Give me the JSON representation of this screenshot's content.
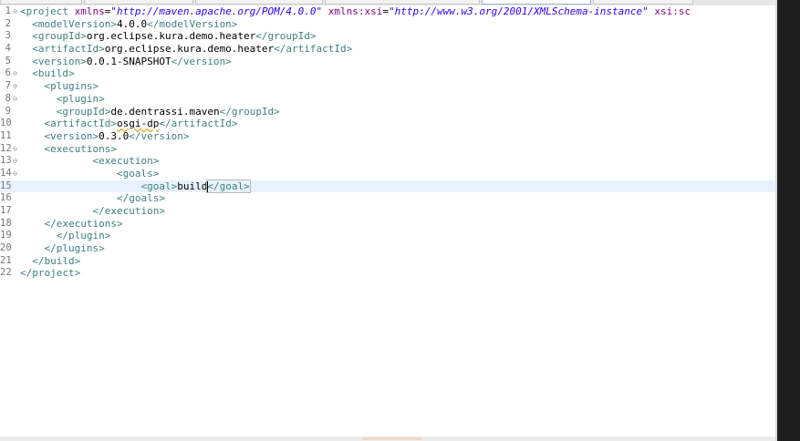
{
  "editor": {
    "lines": [
      {
        "num": "1",
        "fold": "⊖",
        "tokens": [
          [
            "tag",
            "<project "
          ],
          [
            "attr",
            "xmlns"
          ],
          [
            "plain",
            "="
          ],
          [
            "val",
            "\"http://maven.apache.org/POM/4.0.0\""
          ],
          [
            "plain",
            " "
          ],
          [
            "attr",
            "xmlns:xsi"
          ],
          [
            "plain",
            "="
          ],
          [
            "val",
            "\"http://www.w3.org/2001/XMLSchema-instance\""
          ],
          [
            "plain",
            " "
          ],
          [
            "attr",
            "xsi:sc"
          ]
        ]
      },
      {
        "num": "2",
        "fold": "",
        "tokens": [
          [
            "plain",
            "  "
          ],
          [
            "tag",
            "<modelVersion>"
          ],
          [
            "plain",
            "4.0.0"
          ],
          [
            "tag",
            "</modelVersion>"
          ]
        ]
      },
      {
        "num": "3",
        "fold": "",
        "tokens": [
          [
            "plain",
            "  "
          ],
          [
            "tag",
            "<groupId>"
          ],
          [
            "plain",
            "org.eclipse.kura.demo.heater"
          ],
          [
            "tag",
            "</groupId>"
          ]
        ]
      },
      {
        "num": "4",
        "fold": "",
        "tokens": [
          [
            "plain",
            "  "
          ],
          [
            "tag",
            "<artifactId>"
          ],
          [
            "plain",
            "org.eclipse.kura.demo.heater"
          ],
          [
            "tag",
            "</artifactId>"
          ]
        ]
      },
      {
        "num": "5",
        "fold": "",
        "tokens": [
          [
            "plain",
            "  "
          ],
          [
            "tag",
            "<version>"
          ],
          [
            "plain",
            "0.0.1-SNAPSHOT"
          ],
          [
            "tag",
            "</version>"
          ]
        ]
      },
      {
        "num": "6",
        "fold": "⊖",
        "tokens": [
          [
            "plain",
            "  "
          ],
          [
            "tag",
            "<build>"
          ]
        ]
      },
      {
        "num": "7",
        "fold": "⊖",
        "tokens": [
          [
            "plain",
            "    "
          ],
          [
            "tag",
            "<plugins>"
          ]
        ]
      },
      {
        "num": "8",
        "fold": "⊖",
        "tokens": [
          [
            "plain",
            "      "
          ],
          [
            "tag",
            "<plugin>"
          ]
        ]
      },
      {
        "num": "9",
        "fold": "",
        "tokens": [
          [
            "plain",
            "      "
          ],
          [
            "tag",
            "<groupId>"
          ],
          [
            "plain",
            "de.dentrassi.maven"
          ],
          [
            "tag",
            "</groupId>"
          ]
        ]
      },
      {
        "num": "10",
        "fold": "",
        "tokens": [
          [
            "plain",
            "    "
          ],
          [
            "tag",
            "<artifactId>"
          ],
          [
            "squiggle",
            "osgi-dp"
          ],
          [
            "tag",
            "</artifactId>"
          ]
        ]
      },
      {
        "num": "11",
        "fold": "",
        "tokens": [
          [
            "plain",
            "    "
          ],
          [
            "tag",
            "<version>"
          ],
          [
            "plain",
            "0.3.0"
          ],
          [
            "tag",
            "</version>"
          ]
        ]
      },
      {
        "num": "12",
        "fold": "⊖",
        "tokens": [
          [
            "plain",
            "    "
          ],
          [
            "tag",
            "<executions>"
          ]
        ]
      },
      {
        "num": "13",
        "fold": "⊖",
        "tokens": [
          [
            "plain",
            "            "
          ],
          [
            "tag",
            "<execution>"
          ]
        ]
      },
      {
        "num": "14",
        "fold": "⊖",
        "tokens": [
          [
            "plain",
            "                "
          ],
          [
            "tag",
            "<goals>"
          ]
        ]
      },
      {
        "num": "15",
        "fold": "",
        "current": true,
        "tokens": [
          [
            "plain",
            "                    "
          ],
          [
            "tag",
            "<goal>"
          ],
          [
            "plain",
            "build"
          ],
          [
            "caret",
            ""
          ],
          [
            "match",
            "</goal>"
          ]
        ]
      },
      {
        "num": "16",
        "fold": "",
        "tokens": [
          [
            "plain",
            "                "
          ],
          [
            "tag",
            "</goals>"
          ]
        ]
      },
      {
        "num": "17",
        "fold": "",
        "tokens": [
          [
            "plain",
            "            "
          ],
          [
            "tag",
            "</execution>"
          ]
        ]
      },
      {
        "num": "18",
        "fold": "",
        "tokens": [
          [
            "plain",
            "    "
          ],
          [
            "tag",
            "</executions>"
          ]
        ]
      },
      {
        "num": "19",
        "fold": "",
        "tokens": [
          [
            "plain",
            "      "
          ],
          [
            "tag",
            "</plugin>"
          ]
        ]
      },
      {
        "num": "20",
        "fold": "",
        "tokens": [
          [
            "plain",
            "    "
          ],
          [
            "tag",
            "</plugins>"
          ]
        ]
      },
      {
        "num": "21",
        "fold": "",
        "tokens": [
          [
            "plain",
            "  "
          ],
          [
            "tag",
            "</build>"
          ]
        ]
      },
      {
        "num": "22",
        "fold": "",
        "tokens": [
          [
            "tag",
            "</project>"
          ]
        ]
      }
    ]
  }
}
